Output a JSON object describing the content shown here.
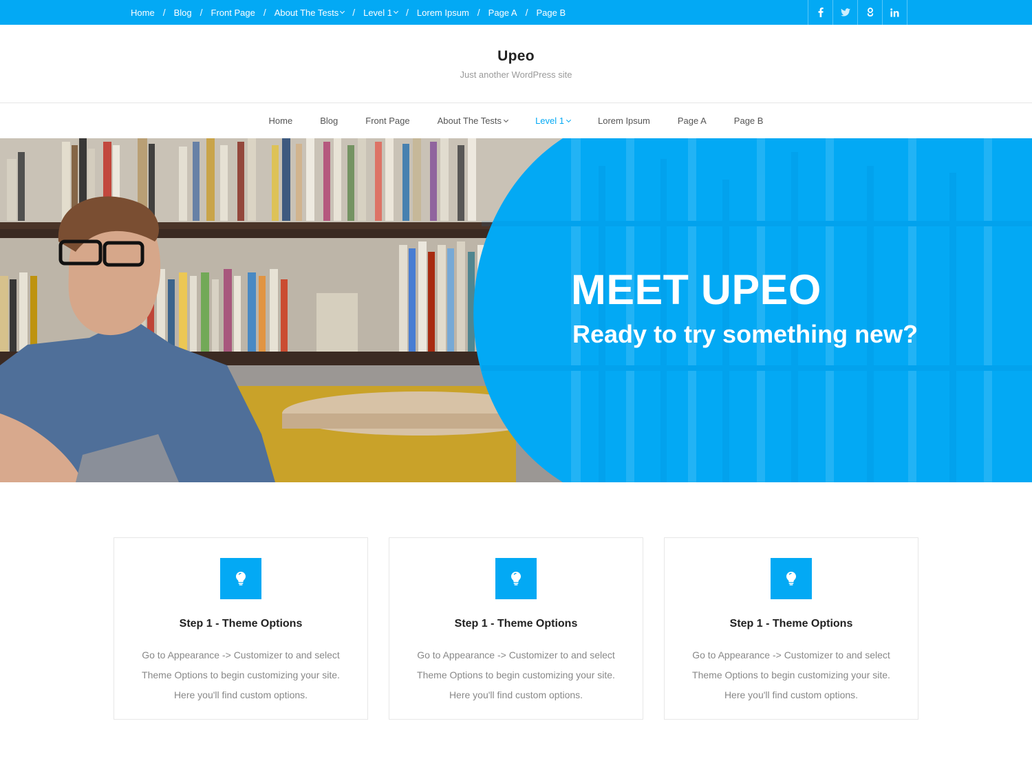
{
  "colors": {
    "accent": "#03a9f4",
    "white": "#ffffff",
    "text": "#222222",
    "muted": "#888888"
  },
  "topbar": {
    "menu": [
      {
        "label": "Home",
        "has_children": false
      },
      {
        "label": "Blog",
        "has_children": false
      },
      {
        "label": "Front Page",
        "has_children": false
      },
      {
        "label": "About The Tests",
        "has_children": true
      },
      {
        "label": "Level 1",
        "has_children": true
      },
      {
        "label": "Lorem Ipsum",
        "has_children": false
      },
      {
        "label": "Page A",
        "has_children": false
      },
      {
        "label": "Page B",
        "has_children": false
      }
    ],
    "social": [
      {
        "icon": "facebook-icon",
        "glyph": "f"
      },
      {
        "icon": "twitter-icon",
        "glyph": "t"
      },
      {
        "icon": "google-plus-icon",
        "glyph": "g"
      },
      {
        "icon": "linkedin-icon",
        "glyph": "in"
      }
    ]
  },
  "branding": {
    "title": "Upeo",
    "description": "Just another WordPress site"
  },
  "mainnav": {
    "items": [
      {
        "label": "Home",
        "has_children": false,
        "active": false
      },
      {
        "label": "Blog",
        "has_children": false,
        "active": false
      },
      {
        "label": "Front Page",
        "has_children": false,
        "active": false
      },
      {
        "label": "About The Tests",
        "has_children": true,
        "active": false
      },
      {
        "label": "Level 1",
        "has_children": true,
        "active": true
      },
      {
        "label": "Lorem Ipsum",
        "has_children": false,
        "active": false
      },
      {
        "label": "Page A",
        "has_children": false,
        "active": false
      },
      {
        "label": "Page B",
        "has_children": false,
        "active": false
      }
    ]
  },
  "hero": {
    "title": "MEET UPEO",
    "subtitle": "Ready to try something new?"
  },
  "features": [
    {
      "icon": "lightbulb-icon",
      "title": "Step 1 - Theme Options",
      "line1": "Go to Appearance -> Customizer to and select",
      "line2": "Theme Options to begin customizing your site.",
      "line3": "Here you'll find custom options."
    },
    {
      "icon": "lightbulb-icon",
      "title": "Step 1 - Theme Options",
      "line1": "Go to Appearance -> Customizer to and select",
      "line2": "Theme Options to begin customizing your site.",
      "line3": "Here you'll find custom options."
    },
    {
      "icon": "lightbulb-icon",
      "title": "Step 1 - Theme Options",
      "line1": "Go to Appearance -> Customizer to and select",
      "line2": "Theme Options to begin customizing your site.",
      "line3": "Here you'll find custom options."
    }
  ]
}
